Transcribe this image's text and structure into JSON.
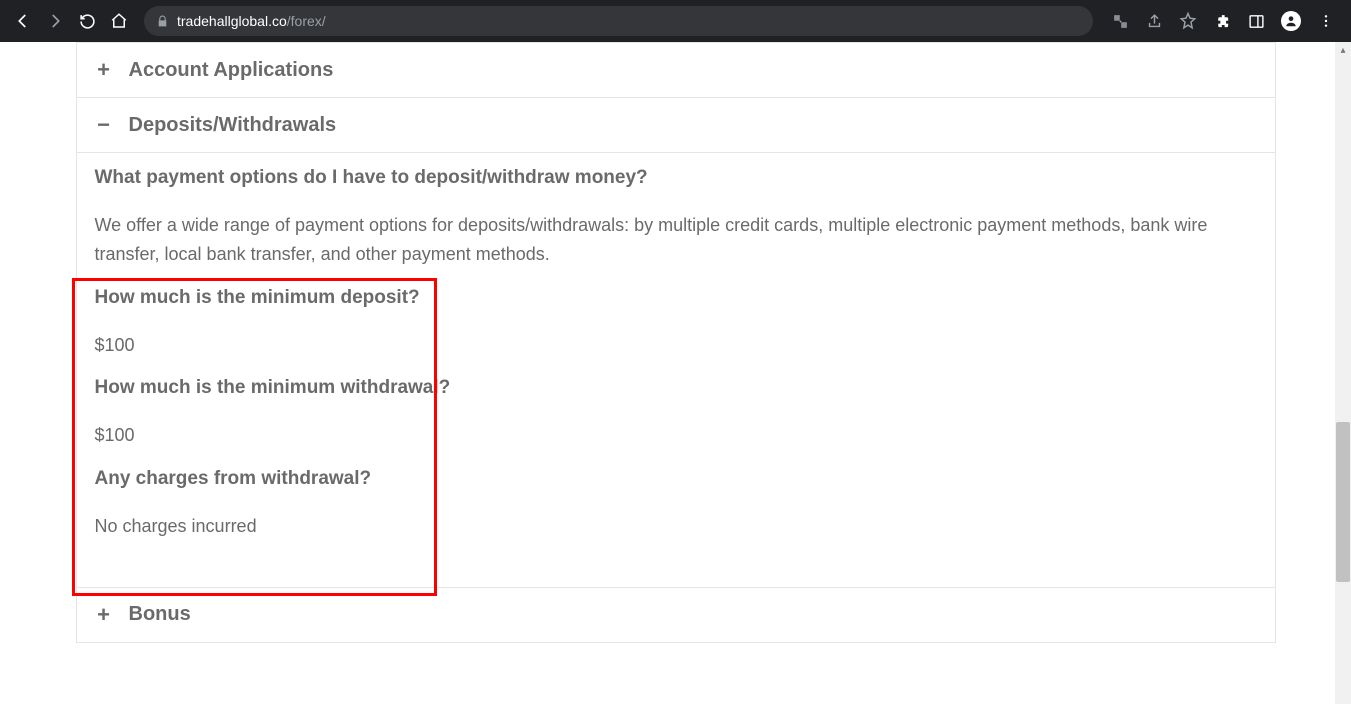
{
  "browser": {
    "url_host": "tradehallglobal.co",
    "url_path": "/forex/"
  },
  "accordion": {
    "items": [
      {
        "icon": "+",
        "title": "Account Applications",
        "expanded": false
      },
      {
        "icon": "−",
        "title": "Deposits/Withdrawals",
        "expanded": true
      },
      {
        "icon": "+",
        "title": "Bonus",
        "expanded": false
      }
    ]
  },
  "faq": {
    "q1": "What payment options do I have to deposit/withdraw money?",
    "a1": "We offer a wide range of payment options for deposits/withdrawals: by multiple credit cards, multiple electronic payment methods, bank wire transfer, local bank transfer, and other payment methods.",
    "q2": "How much is the minimum deposit?",
    "a2": "$100",
    "q3": "How much is the minimum withdrawal?",
    "a3": "$100",
    "q4": "Any charges from withdrawal?",
    "a4": "No charges incurred"
  }
}
